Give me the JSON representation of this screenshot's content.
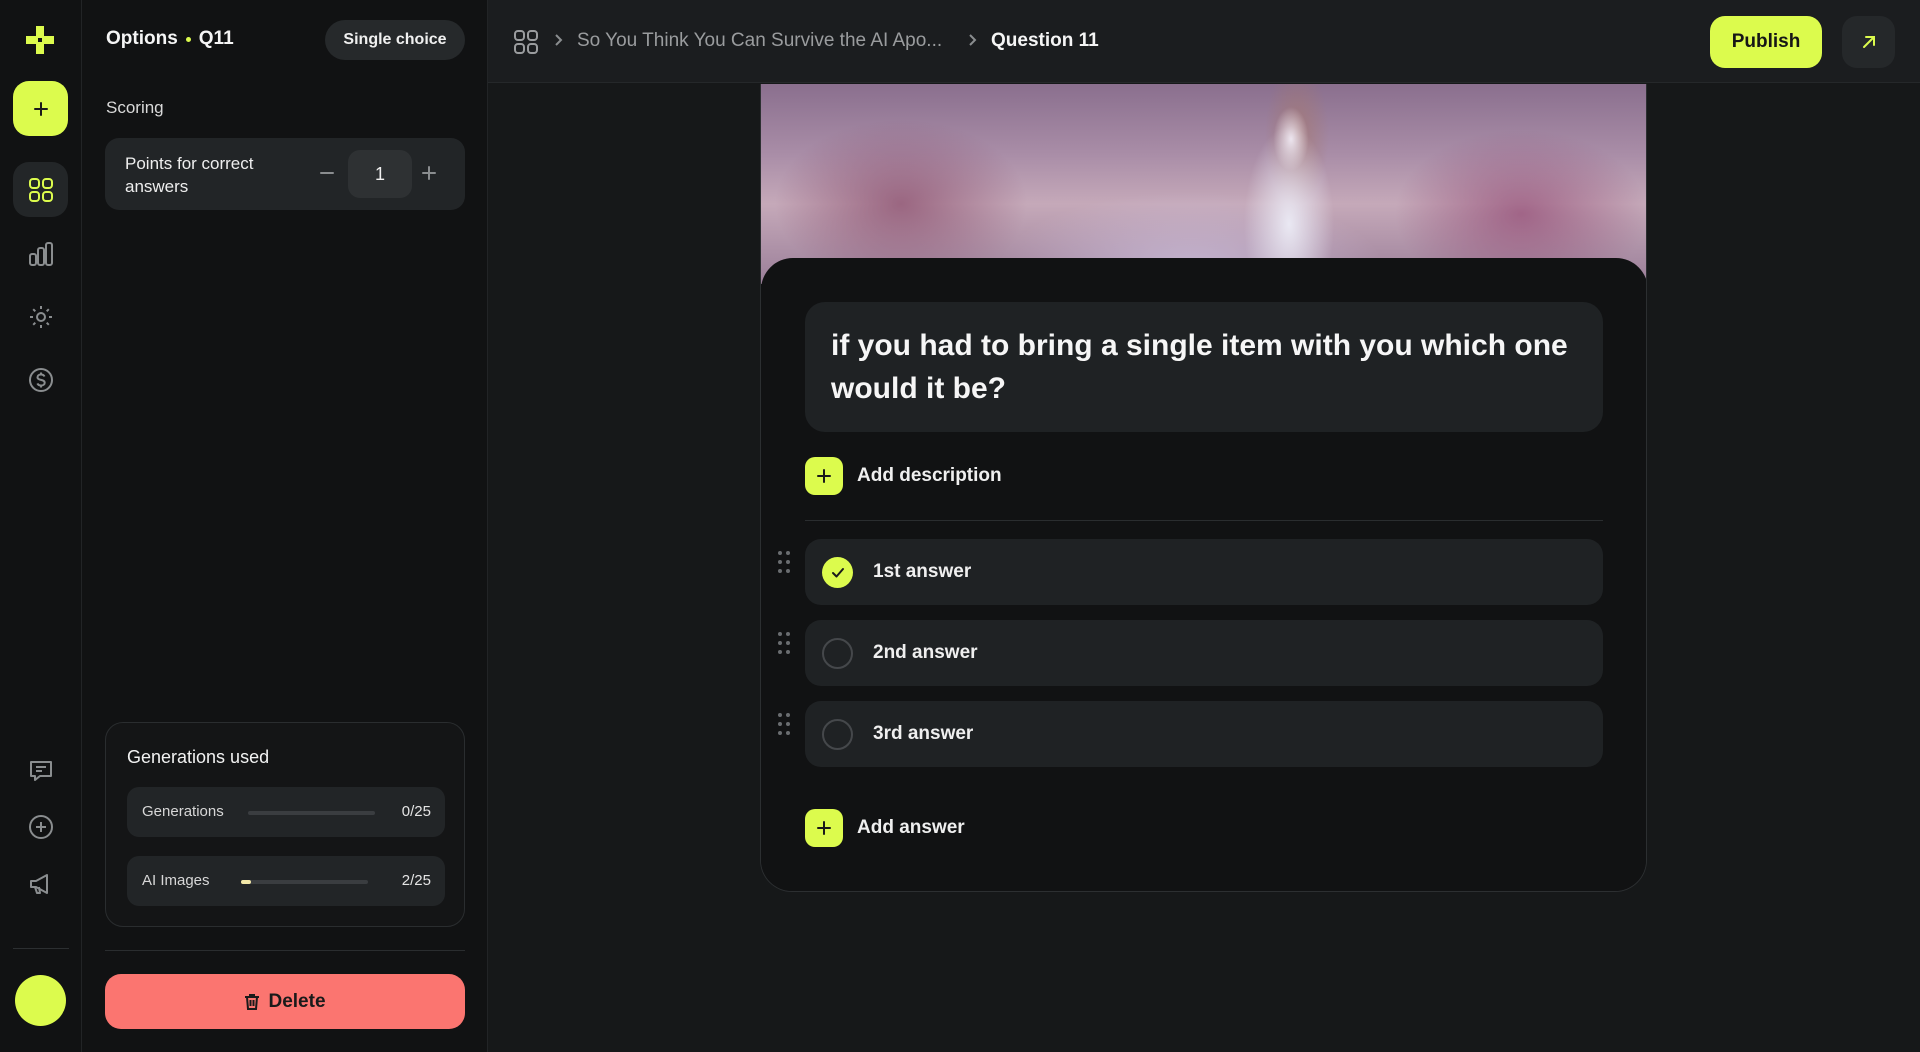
{
  "app": {
    "accent": "#dcfb4d",
    "danger": "#fb7570"
  },
  "rail": {
    "logo_icon": "puzzle-cross-logo",
    "add_icon": "plus-icon",
    "nav": [
      "grid-icon",
      "bar-chart-icon",
      "gear-icon",
      "dollar-icon"
    ],
    "bottom": [
      "feedback-icon",
      "plus-circle-icon",
      "megaphone-icon"
    ]
  },
  "panel": {
    "title": "Options",
    "question_code": "Q11",
    "type_chip": "Single choice",
    "section_label": "Scoring",
    "points_label": "Points for correct answers",
    "points_value": "1",
    "generations": {
      "title": "Generations used",
      "rows": [
        {
          "label": "Generations",
          "count": "0/25",
          "fraction": 0.0
        },
        {
          "label": "AI Images",
          "count": "2/25",
          "fraction": 0.08
        }
      ]
    },
    "delete_label": "Delete"
  },
  "topbar": {
    "breadcrumb_quiz": "So You Think You Can Survive the AI Apo...",
    "breadcrumb_question": "Question 11",
    "publish_label": "Publish"
  },
  "card": {
    "question": "if you had to bring a single item with you which one would it be?",
    "add_description": "Add description",
    "answers": [
      {
        "text": "1st answer",
        "correct": true
      },
      {
        "text": "2nd answer",
        "correct": false
      },
      {
        "text": "3rd answer",
        "correct": false
      }
    ],
    "add_answer": "Add answer"
  }
}
